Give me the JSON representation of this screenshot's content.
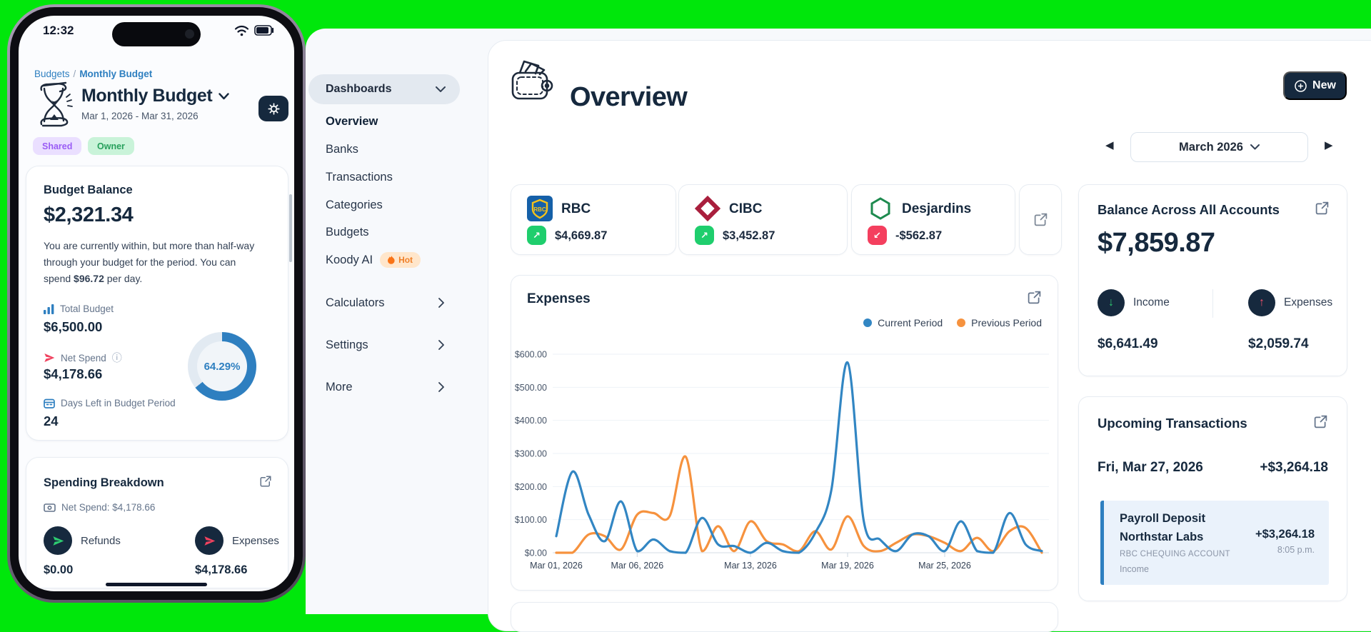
{
  "colors": {
    "background_green": "#00E70B",
    "navy": "#16293E",
    "accent_blue": "#3286C3",
    "accent_orange": "#F6923E",
    "positive_green": "#1FCE6D",
    "negative_red": "#F43F5E",
    "link_blue": "#2E7FC0"
  },
  "phone": {
    "status_bar": {
      "time": "12:32"
    },
    "breadcrumb": {
      "part1": "Budgets",
      "separator": "/",
      "part2": "Monthly Budget"
    },
    "header": {
      "title": "Monthly Budget",
      "date_range": "Mar 1, 2026 - Mar 31, 2026",
      "badge_shared": "Shared",
      "badge_owner": "Owner"
    },
    "budget_balance": {
      "title": "Budget Balance",
      "amount": "$2,321.34",
      "description_pre": "You are currently within, but more than half-way through your budget for the period. You can spend ",
      "description_bold": "$96.72",
      "description_post": " per day.",
      "total_budget_label": "Total Budget",
      "total_budget_value": "$6,500.00",
      "net_spend_label": "Net Spend",
      "net_spend_value": "$4,178.66",
      "days_left_label": "Days Left in Budget Period",
      "days_left_value": "24",
      "donut_label": "64.29%",
      "donut_percent": 64.29
    },
    "spending_breakdown": {
      "title": "Spending Breakdown",
      "net_spend_line": "Net Spend: $4,178.66",
      "refunds_label": "Refunds",
      "refunds_value": "$0.00",
      "expenses_label": "Expenses",
      "expenses_value": "$4,178.66"
    }
  },
  "sidebar": {
    "group_label": "Dashboards",
    "hot_label": "Hot",
    "active_item": "Overview",
    "items": [
      {
        "label": "Overview"
      },
      {
        "label": "Banks"
      },
      {
        "label": "Transactions"
      },
      {
        "label": "Categories"
      },
      {
        "label": "Budgets"
      },
      {
        "label": "Koody AI",
        "hot": true
      }
    ],
    "links": [
      {
        "label": "Calculators"
      },
      {
        "label": "Settings"
      },
      {
        "label": "More"
      }
    ]
  },
  "main": {
    "page_title": "Overview",
    "new_button_label": "New",
    "month_selector": {
      "value": "March 2026"
    },
    "accounts": [
      {
        "name": "RBC",
        "value": "$4,669.87",
        "trend": "up"
      },
      {
        "name": "CIBC",
        "value": "$3,452.87",
        "trend": "up"
      },
      {
        "name": "Desjardins",
        "value": "-$562.87",
        "trend": "down"
      }
    ],
    "balance_card": {
      "title": "Balance Across All Accounts",
      "total": "$7,859.87",
      "income_label": "Income",
      "income_value": "$6,641.49",
      "expenses_label": "Expenses",
      "expenses_value": "$2,059.74"
    },
    "upcoming_card": {
      "title": "Upcoming Transactions",
      "group_date": "Fri, Mar 27, 2026",
      "group_total": "+$3,264.18",
      "transaction": {
        "title": "Payroll Deposit",
        "merchant": "Northstar Labs",
        "account": "RBC CHEQUING ACCOUNT",
        "category": "Income",
        "amount": "+$3,264.18",
        "time": "8:05 p.m."
      }
    }
  },
  "chart_data": {
    "type": "line",
    "title": "Expenses",
    "legend_position": "top-right",
    "grid": true,
    "ylim": [
      0,
      600
    ],
    "y_ticks": [
      "$600.00",
      "$500.00",
      "$400.00",
      "$300.00",
      "$200.00",
      "$100.00",
      "$0.00"
    ],
    "x_range_days": [
      1,
      31
    ],
    "x_labels": [
      {
        "day": 1,
        "label": "Mar 01, 2026"
      },
      {
        "day": 6,
        "label": "Mar 06, 2026"
      },
      {
        "day": 13,
        "label": "Mar 13, 2026"
      },
      {
        "day": 19,
        "label": "Mar 19, 2026"
      },
      {
        "day": 25,
        "label": "Mar 25, 2026"
      }
    ],
    "series": [
      {
        "name": "Current Period",
        "color": "#3286C3",
        "values": [
          50,
          245,
          115,
          35,
          155,
          5,
          40,
          5,
          0,
          105,
          25,
          20,
          0,
          30,
          5,
          0,
          60,
          190,
          575,
          95,
          40,
          5,
          55,
          50,
          5,
          95,
          5,
          0,
          120,
          25,
          5
        ]
      },
      {
        "name": "Previous Period",
        "color": "#F6923E",
        "values": [
          0,
          0,
          55,
          50,
          10,
          115,
          120,
          110,
          290,
          5,
          80,
          5,
          95,
          35,
          25,
          5,
          65,
          10,
          110,
          20,
          5,
          30,
          55,
          50,
          30,
          5,
          45,
          5,
          65,
          75,
          0
        ]
      }
    ]
  }
}
